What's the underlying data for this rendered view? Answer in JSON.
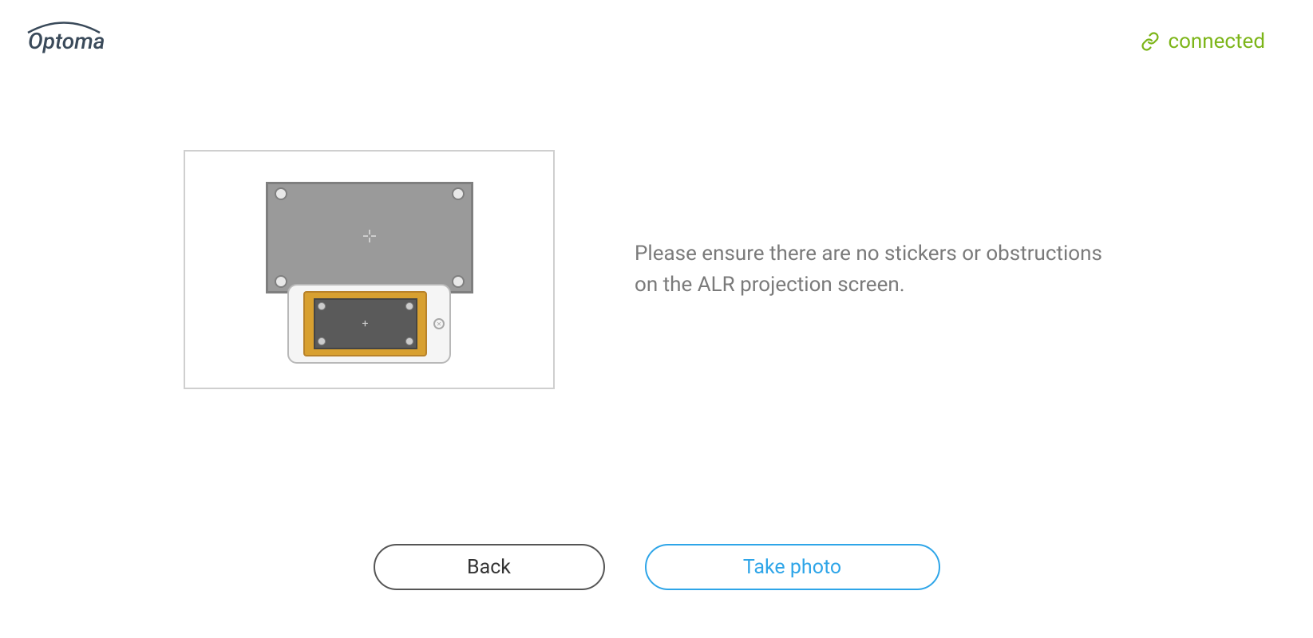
{
  "header": {
    "brand": "Optoma",
    "status_label": "connected"
  },
  "main": {
    "instruction_text": "Please ensure there are no stickers or obstructions on the ALR projection screen."
  },
  "buttons": {
    "back_label": "Back",
    "primary_label": "Take photo"
  },
  "colors": {
    "status_green": "#7cb518",
    "primary_blue": "#2ea5e8"
  }
}
